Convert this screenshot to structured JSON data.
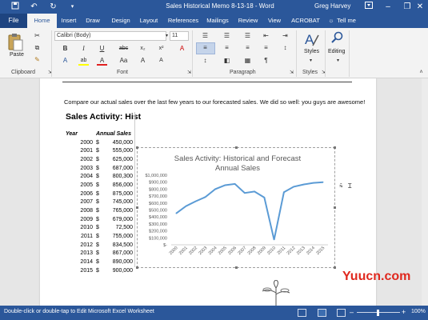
{
  "title_bar": {
    "document_title": "Sales Historical Memo 8-13-18  -  Word",
    "user_name": "Greg Harvey",
    "quick_access": [
      "save-icon",
      "undo-icon",
      "redo-icon",
      "customize-icon"
    ],
    "window_controls": [
      "ribbon-display-icon",
      "minimize-icon",
      "restore-icon",
      "close-icon"
    ]
  },
  "tabs": {
    "file": "File",
    "items": [
      "Home",
      "Insert",
      "Draw",
      "Design",
      "Layout",
      "References",
      "Mailings",
      "Review",
      "View",
      "ACROBAT"
    ],
    "active": "Home",
    "tell_me": "Tell me"
  },
  "ribbon": {
    "clipboard": {
      "label": "Clipboard",
      "paste": "Paste"
    },
    "font": {
      "label": "Font",
      "font_name": "Calibri (Body)",
      "font_size": "11"
    },
    "paragraph": {
      "label": "Paragraph"
    },
    "styles": {
      "label": "Styles",
      "button": "Styles"
    },
    "editing": {
      "button": "Editing"
    }
  },
  "document": {
    "body_text": "Compare our actual sales over the last few years to our forecasted sales. We did so well: you guys are awesome!",
    "sheet_title": "Sales Activity: Hist",
    "table_headers": [
      "Year",
      "Annual Sales"
    ],
    "currency_symbol": "$",
    "rows": [
      [
        "2000",
        "450,000"
      ],
      [
        "2001",
        "555,000"
      ],
      [
        "2002",
        "625,000"
      ],
      [
        "2003",
        "687,000"
      ],
      [
        "2004",
        "800,300"
      ],
      [
        "2005",
        "856,000"
      ],
      [
        "2006",
        "875,000"
      ],
      [
        "2007",
        "745,000"
      ],
      [
        "2008",
        "765,000"
      ],
      [
        "2009",
        "679,000"
      ],
      [
        "2010",
        "72,500"
      ],
      [
        "2011",
        "755,000"
      ],
      [
        "2012",
        "834,500"
      ],
      [
        "2013",
        "867,000"
      ],
      [
        "2014",
        "890,000"
      ],
      [
        "2015",
        "900,000"
      ]
    ]
  },
  "chart_data": {
    "type": "line",
    "title": "Sales Activity: Historical and Forecast Annual Sales",
    "categories": [
      "2000",
      "2001",
      "2002",
      "2003",
      "2004",
      "2005",
      "2006",
      "2007",
      "2008",
      "2009",
      "2010",
      "2011",
      "2012",
      "2013",
      "2014",
      "2015"
    ],
    "series": [
      {
        "values": [
          450000,
          555000,
          625000,
          687000,
          800300,
          856000,
          875000,
          745000,
          765000,
          679000,
          72500,
          755000,
          834500,
          867000,
          890000,
          900000
        ]
      }
    ],
    "yticks": [
      "$1,000,000",
      "$900,000",
      "$800,000",
      "$700,000",
      "$600,000",
      "$500,000",
      "$400,000",
      "$300,000",
      "$200,000",
      "$100,000",
      "$-"
    ],
    "ylim": [
      0,
      1000000
    ],
    "grid": false,
    "legend": "none",
    "line_color": "#5b9bd5"
  },
  "status_bar": {
    "text": "Double-click or double-tap to Edit Microsoft Excel Worksheet",
    "zoom": "100%"
  },
  "watermark": "Yuucn.com",
  "colors": {
    "word_blue": "#2b579a",
    "ribbon_bg": "#f3f3f3",
    "accent": "#2b579a"
  }
}
